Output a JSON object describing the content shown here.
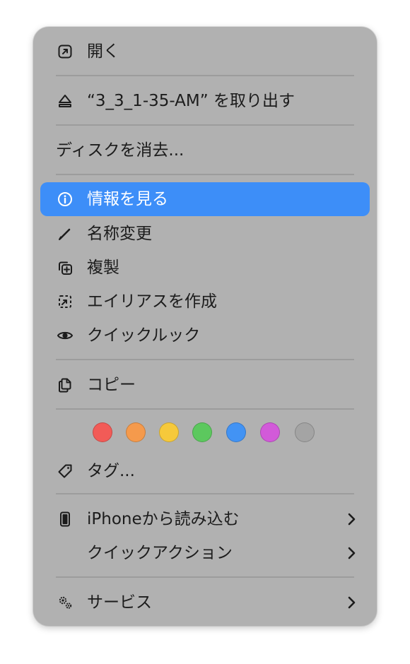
{
  "menu": {
    "open": "開く",
    "eject": "“3_3_1-35-AM” を取り出す",
    "erase": "ディスクを消去...",
    "get_info": "情報を見る",
    "rename": "名称変更",
    "duplicate": "複製",
    "make_alias": "エイリアスを作成",
    "quick_look": "クイックルック",
    "copy": "コピー",
    "tags_label": "タグ...",
    "import_from_iphone": "iPhoneから読み込む",
    "quick_actions": "クイックアクション",
    "services": "サービス"
  },
  "selected_item": "情報を見る",
  "tag_colors": [
    {
      "name": "red",
      "hex": "#f25b57"
    },
    {
      "name": "orange",
      "hex": "#f59a4c"
    },
    {
      "name": "yellow",
      "hex": "#f6c93b"
    },
    {
      "name": "green",
      "hex": "#5cc85e"
    },
    {
      "name": "blue",
      "hex": "#4293f4"
    },
    {
      "name": "purple",
      "hex": "#d25ad9"
    },
    {
      "name": "gray",
      "hex": "#a4a4a4"
    }
  ],
  "colors": {
    "menu_background": "#b1b1b1",
    "highlight": "#3d8ef8",
    "separator": "#9c9c9c",
    "text": "#1c1c1c"
  },
  "icons": {
    "open": "open-arrow-icon",
    "eject": "eject-icon",
    "get_info": "info-circle-icon",
    "rename": "pencil-icon",
    "duplicate": "duplicate-icon",
    "make_alias": "alias-icon",
    "quick_look": "eye-icon",
    "copy": "copy-doc-icon",
    "tags": "tag-icon",
    "import_from_iphone": "iphone-icon",
    "services": "gears-icon",
    "submenu": "chevron-right-icon"
  }
}
